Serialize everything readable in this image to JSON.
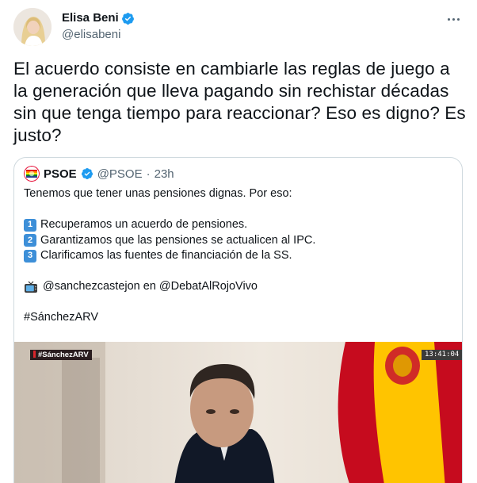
{
  "author": {
    "display_name": "Elisa Beni",
    "handle": "@elisabeni",
    "verified": true,
    "avatar_icon": "profile-photo"
  },
  "more_icon": "more-horizontal-icon",
  "tweet_text": "El acuerdo consiste en cambiarle las reglas de juego a la generación que lleva pagando sin rechistar décadas sin que tenga tiempo para reaccionar? Eso es digno? Es justo?",
  "quote": {
    "display_name": "PSOE",
    "handle": "@PSOE",
    "separator": "·",
    "time": "23h",
    "verified": true,
    "lines": {
      "intro": "Tenemos que tener unas pensiones dignas. Por eso:",
      "item1_key": "1",
      "item1": "Recuperamos un acuerdo de pensiones.",
      "item2_key": "2",
      "item2": "Garantizamos que las pensiones se actualicen al IPC.",
      "item3_key": "3",
      "item3": "Clarificamos las fuentes de financiación de la SS.",
      "tv": "@sanchezcastejon en @DebatAlRojoVivo",
      "hashtag": "#SánchezARV"
    },
    "video": {
      "tag": "#SánchezARV",
      "timestamp": "13:41:04"
    }
  },
  "colors": {
    "verified_blue": "#1d9bf0",
    "text_primary": "#0f1419",
    "text_secondary": "#536471",
    "border": "#cfd9de",
    "keycap_blue": "#3d8fd8"
  }
}
